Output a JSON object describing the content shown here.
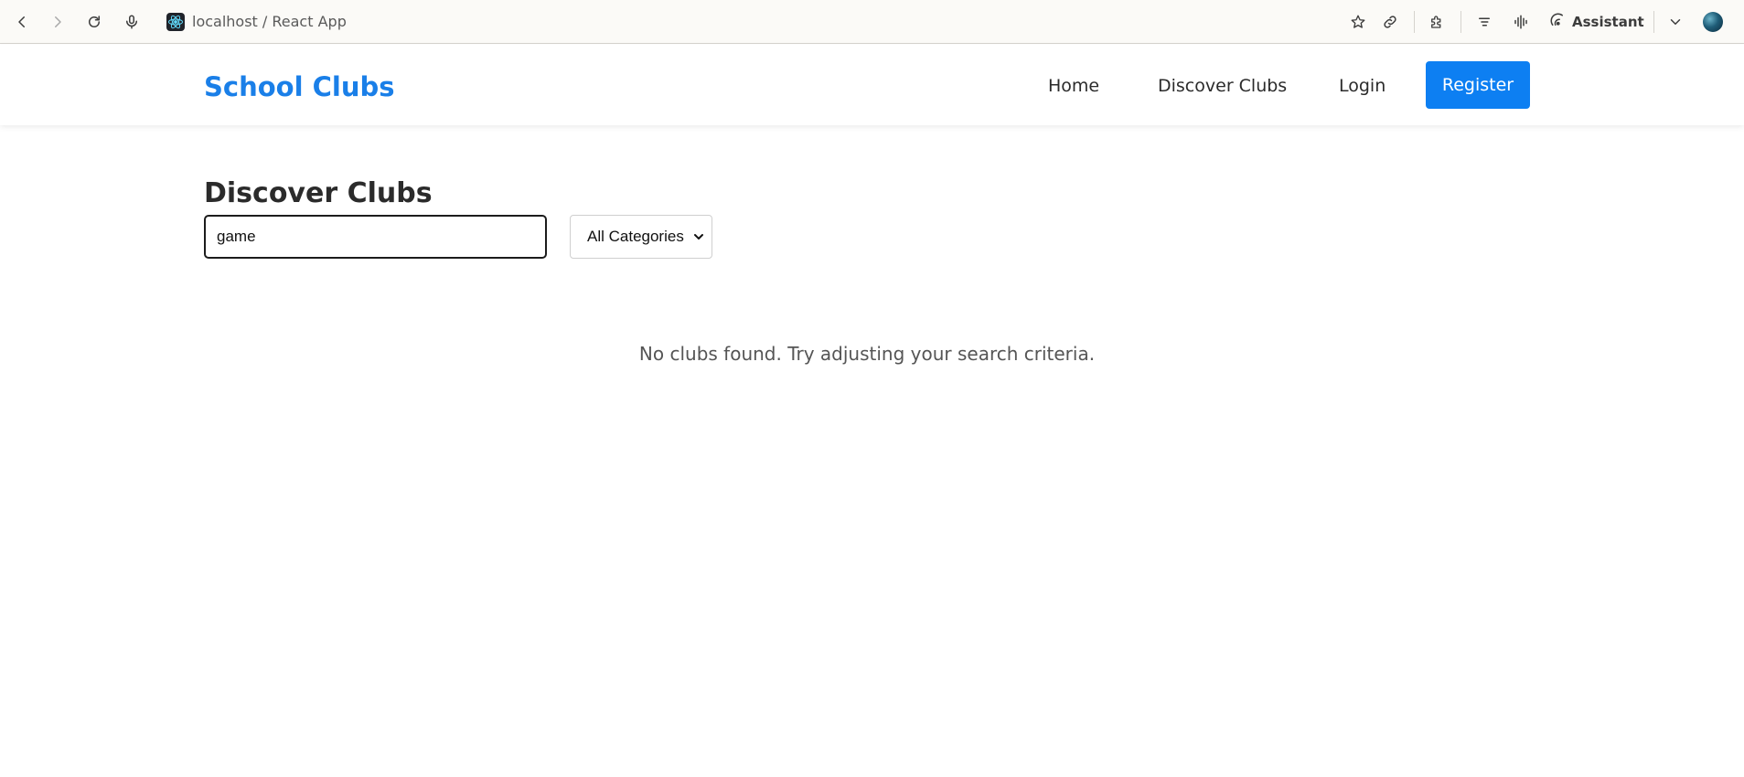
{
  "browser": {
    "tab_title": "localhost / React App",
    "assistant_label": "Assistant",
    "icons": [
      "back-icon",
      "forward-icon",
      "reload-icon",
      "microphone-icon",
      "react-favicon",
      "star-icon",
      "link-icon",
      "extensions-icon",
      "menu-lines-icon",
      "audio-wave-icon",
      "assistant-icon",
      "chevron-down-icon",
      "profile-avatar"
    ]
  },
  "navbar": {
    "brand": "School Clubs",
    "links": [
      "Home",
      "Discover Clubs",
      "Login"
    ],
    "register_label": "Register",
    "accent_color": "#0d7ff2"
  },
  "main": {
    "title": "Discover Clubs",
    "search_value": "game",
    "category_selected": "All Categories",
    "empty_message": "No clubs found. Try adjusting your search criteria."
  }
}
